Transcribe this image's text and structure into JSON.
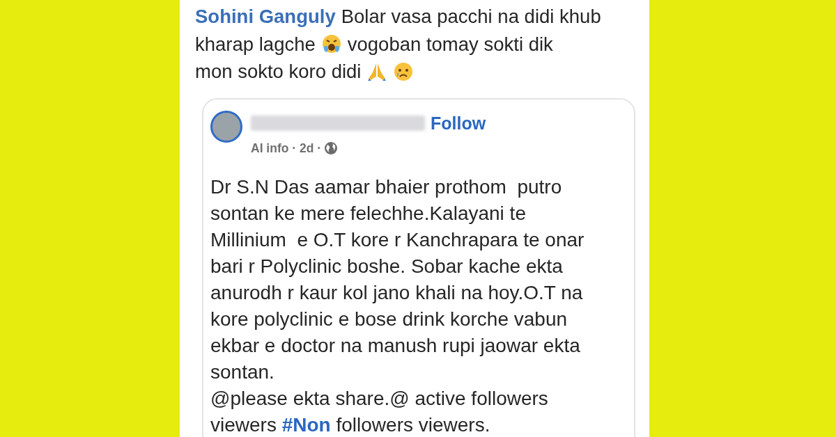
{
  "comment": {
    "lines": [
      [
        {
          "kind": "author",
          "text": "Sohini Ganguly"
        },
        {
          "kind": "text",
          "text": "Bolar vasa pacchi na didi khub"
        }
      ],
      [
        {
          "kind": "text",
          "text": "kharap lagche"
        },
        {
          "kind": "crying"
        },
        {
          "kind": "text",
          "text": "vogoban tomay sokti dik"
        }
      ],
      [
        {
          "kind": "text",
          "text": "mon sokto koro didi"
        },
        {
          "kind": "praying"
        },
        {
          "kind": "sad"
        }
      ]
    ]
  },
  "shared_post": {
    "follow": "Follow",
    "meta": "AI info · 2d ·",
    "paragraphs": [
      {
        "segments": [
          {
            "kind": "text",
            "text": "Dr S.N Das aamar bhaier prothom  putro sontan ke mere felechhe.Kalayani te Millinium  e O.T kore r Kanchrapara te onar bari r Polyclinic boshe. Sobar kache ekta anurodh r kaur kol jano khali na hoy.O.T na kore polyclinic e bose drink korche vabun ekbar e doctor na manush rupi jaowar ekta sontan."
          }
        ]
      },
      {
        "segments": [
          {
            "kind": "text",
            "text": "@please ekta share.@ active followers viewers "
          },
          {
            "kind": "hashtag",
            "text": "#Non"
          },
          {
            "kind": "text",
            "text": " followers viewers."
          }
        ]
      }
    ]
  }
}
